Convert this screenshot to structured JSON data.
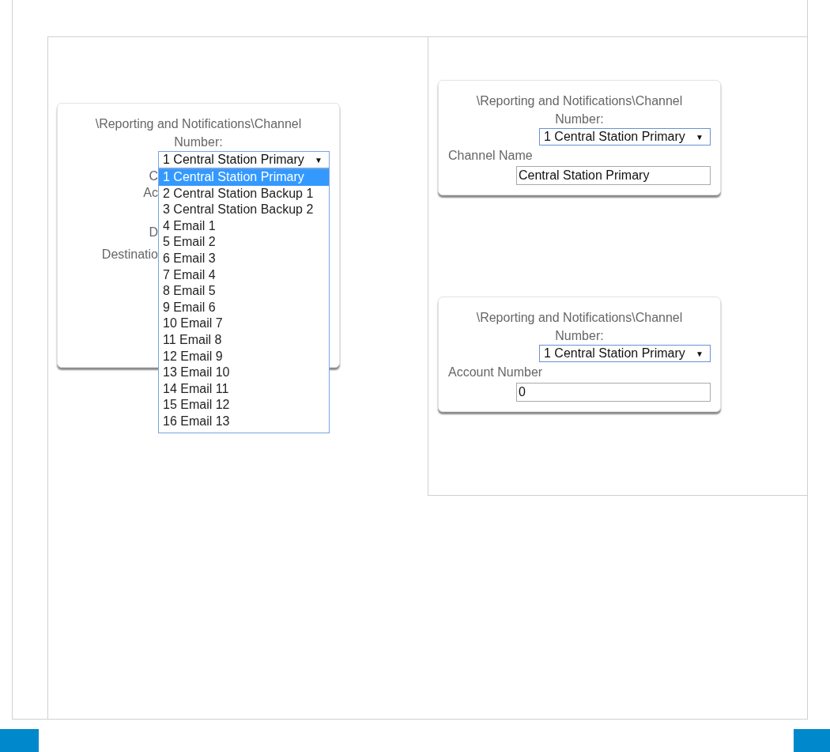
{
  "left_panel": {
    "card": {
      "title": "\\Reporting and Notifications\\Channel",
      "number_label": "Number:",
      "select": {
        "value": "1 Central Station Primary",
        "arrow": "▼",
        "expanded": true
      },
      "hidden_labels": [
        "C",
        "Ac",
        "D",
        "Destinatio"
      ],
      "options": [
        {
          "label": "1 Central Station Primary",
          "selected": true
        },
        {
          "label": "2 Central Station Backup 1",
          "selected": false
        },
        {
          "label": "3 Central Station Backup 2",
          "selected": false
        },
        {
          "label": "4 Email 1",
          "selected": false
        },
        {
          "label": "5 Email 2",
          "selected": false
        },
        {
          "label": "6 Email 3",
          "selected": false
        },
        {
          "label": "7 Email 4",
          "selected": false
        },
        {
          "label": "8 Email 5",
          "selected": false
        },
        {
          "label": "9 Email 6",
          "selected": false
        },
        {
          "label": "10 Email 7",
          "selected": false
        },
        {
          "label": "11 Email 8",
          "selected": false
        },
        {
          "label": "12 Email 9",
          "selected": false
        },
        {
          "label": "13 Email 10",
          "selected": false
        },
        {
          "label": "14 Email 11",
          "selected": false
        },
        {
          "label": "15 Email 12",
          "selected": false
        },
        {
          "label": "16 Email 13",
          "selected": false
        }
      ]
    }
  },
  "right_panel": {
    "cards": [
      {
        "title": "\\Reporting and Notifications\\Channel",
        "number_label": "Number:",
        "select": {
          "value": "1 Central Station Primary",
          "arrow": "▼"
        },
        "field_label": "Channel Name",
        "field_value": "Central Station Primary"
      },
      {
        "title": "\\Reporting and Notifications\\Channel",
        "number_label": "Number:",
        "select": {
          "value": "1 Central Station Primary",
          "arrow": "▼"
        },
        "field_label": "Account Number",
        "field_value": "0"
      }
    ]
  }
}
